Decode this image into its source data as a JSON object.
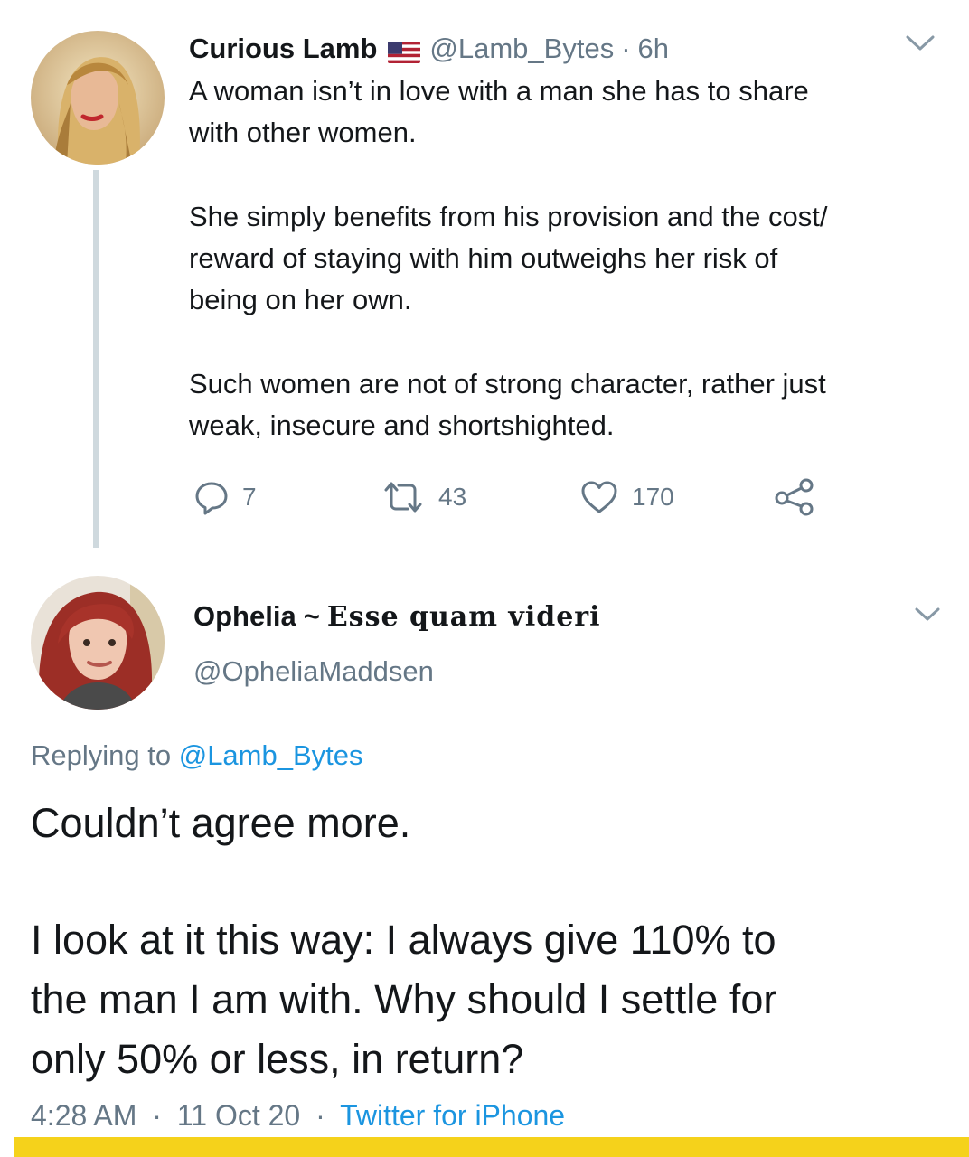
{
  "tweet": {
    "author_name": "Curious Lamb",
    "flag_icon": "us-flag-icon",
    "handle": "@Lamb_Bytes",
    "separator": "·",
    "time_ago": "6h",
    "paragraphs": [
      [
        "A woman isn’t in love with a man she has to share",
        "with other women."
      ],
      [
        "She simply benefits from his provision and the cost/",
        "reward of staying with him outweighs her risk of",
        "being on her own."
      ],
      [
        "Such women are not of strong character, rather just",
        "weak, insecure and shortshighted."
      ]
    ],
    "actions": {
      "reply_count": "7",
      "retweet_count": "43",
      "like_count": "170"
    }
  },
  "reply": {
    "author_name": "Ophelia",
    "tilde": "~",
    "motto": "Esse quam videri",
    "handle": "@OpheliaMaddsen",
    "replying_label": "Replying to",
    "replying_handle": "@Lamb_Bytes",
    "paragraphs": [
      [
        "Couldn’t agree more."
      ],
      [
        "I look at it this way: I always give 110% to",
        "the man I am with. Why should I settle for",
        "only 50% or less, in return?"
      ]
    ],
    "meta": {
      "time": "4:28 AM",
      "separator": "·",
      "date": "11 Oct 20",
      "source": "Twitter for iPhone"
    }
  },
  "colors": {
    "text": "#14171a",
    "secondary": "#657786",
    "link": "#1b95e0",
    "thread_line": "#cfd9de",
    "highlight_bar": "#f5d21b"
  }
}
